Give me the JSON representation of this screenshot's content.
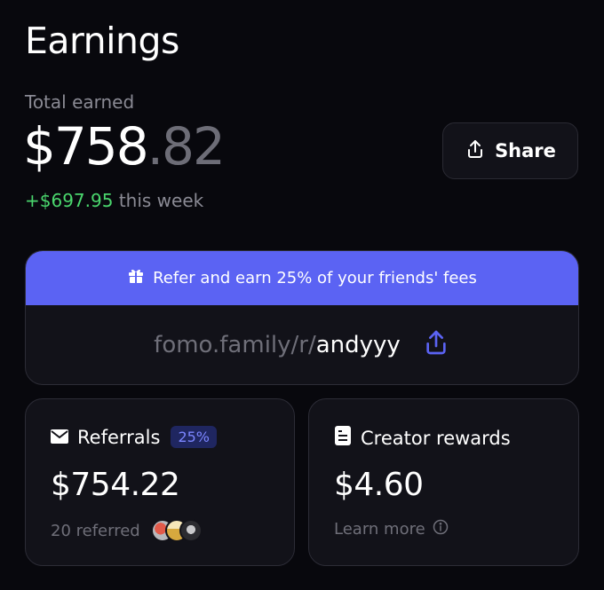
{
  "header": {
    "title": "Earnings"
  },
  "total": {
    "label": "Total earned",
    "dollars": "$758",
    "cents": ".82",
    "week_gain": "+$697.95",
    "week_suffix": " this week"
  },
  "share_button": {
    "label": "Share",
    "icon": "share-icon"
  },
  "refer": {
    "banner_text": "Refer and earn 25% of your friends' fees",
    "banner_icon": "gift-icon",
    "link_base": "fomo.family/r/",
    "link_user": "andyyy",
    "link_icon": "share-icon",
    "accent": "#5b63f3"
  },
  "referrals": {
    "label": "Referrals",
    "badge": "25%",
    "amount": "$754.22",
    "footer": "20 referred",
    "icon": "mail-icon"
  },
  "creator": {
    "label": "Creator rewards",
    "amount": "$4.60",
    "footer": "Learn more",
    "icon": "receipt-icon"
  },
  "colors": {
    "positive": "#4ad66d",
    "background": "#08080d",
    "card": "#121219"
  }
}
